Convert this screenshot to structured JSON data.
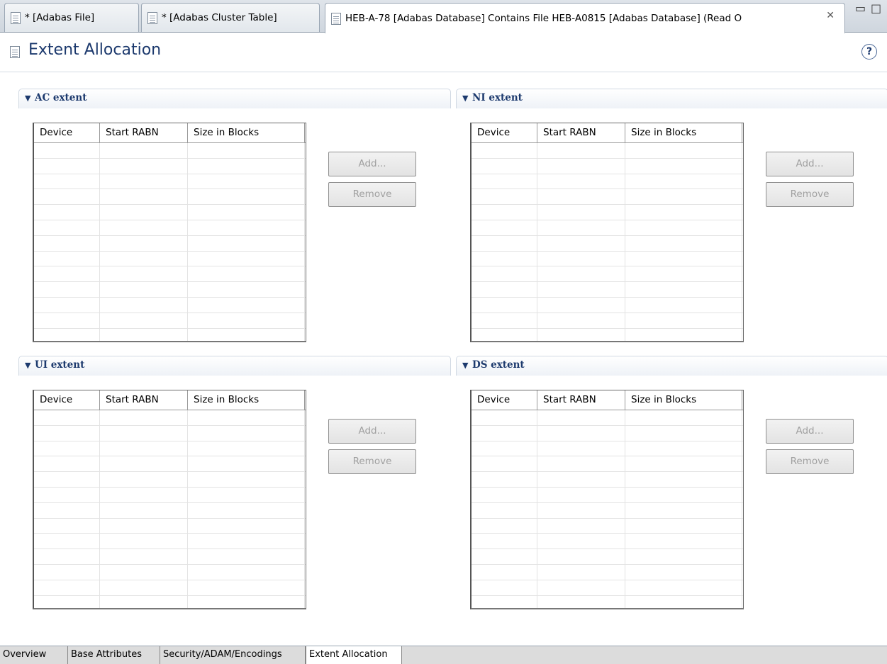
{
  "editor_tabs": [
    {
      "label": "* [Adabas File]"
    },
    {
      "label": "* [Adabas Cluster Table]"
    },
    {
      "label": "HEB-A-78 [Adabas Database] Contains File HEB-A0815 [Adabas Database] (Read O"
    }
  ],
  "header": {
    "title": "Extent Allocation",
    "help": "?"
  },
  "columns": [
    "Device",
    "Start RABN",
    "Size in Blocks"
  ],
  "buttons": {
    "add": "Add...",
    "remove": "Remove"
  },
  "sections": [
    {
      "title": "AC extent"
    },
    {
      "title": "NI extent"
    },
    {
      "title": "UI extent"
    },
    {
      "title": "DS extent"
    }
  ],
  "bottom_tabs": [
    {
      "label": "Overview"
    },
    {
      "label": "Base Attributes"
    },
    {
      "label": "Security/ADAM/Encodings"
    },
    {
      "label": "Extent Allocation",
      "active": true
    }
  ]
}
